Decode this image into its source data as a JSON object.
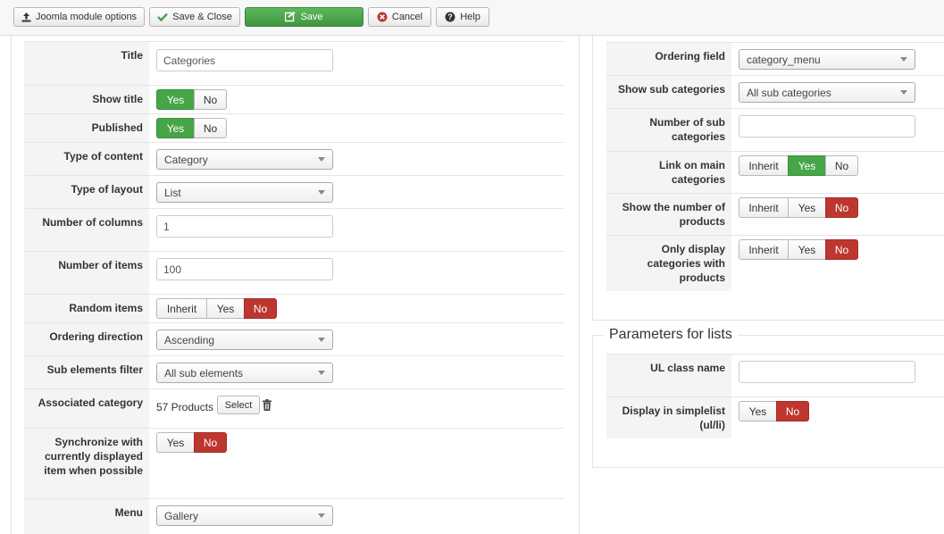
{
  "toolbar": {
    "options_label": "Joomla module options",
    "save_close_label": "Save & Close",
    "save_label": "Save",
    "cancel_label": "Cancel",
    "help_label": "Help"
  },
  "left": {
    "title": {
      "label": "Title",
      "value": "Categories"
    },
    "show_title": {
      "label": "Show title",
      "yes": "Yes",
      "no": "No",
      "selected": "yes"
    },
    "published": {
      "label": "Published",
      "yes": "Yes",
      "no": "No",
      "selected": "yes"
    },
    "type_of_content": {
      "label": "Type of content",
      "value": "Category"
    },
    "type_of_layout": {
      "label": "Type of layout",
      "value": "List"
    },
    "number_of_columns": {
      "label": "Number of columns",
      "value": "1"
    },
    "number_of_items": {
      "label": "Number of items",
      "value": "100"
    },
    "random_items": {
      "label": "Random items",
      "inherit": "Inherit",
      "yes": "Yes",
      "no": "No",
      "selected": "no"
    },
    "ordering_direction": {
      "label": "Ordering direction",
      "value": "Ascending"
    },
    "sub_elements_filter": {
      "label": "Sub elements filter",
      "value": "All sub elements"
    },
    "associated_category": {
      "label": "Associated category",
      "value": "57 Products",
      "select_label": "Select"
    },
    "synchronize": {
      "label": "Synchronize with currently displayed item when possible",
      "yes": "Yes",
      "no": "No",
      "selected": "no"
    },
    "menu": {
      "label": "Menu",
      "value": "Gallery"
    }
  },
  "right": {
    "ordering_field": {
      "label": "Ordering field",
      "value": "category_menu"
    },
    "show_sub_categories": {
      "label": "Show sub categories",
      "value": "All sub categories"
    },
    "number_of_sub_categories": {
      "label": "Number of sub categories",
      "value": ""
    },
    "link_on_main_categories": {
      "label": "Link on main categories",
      "inherit": "Inherit",
      "yes": "Yes",
      "no": "No",
      "selected": "yes"
    },
    "show_number_of_products": {
      "label": "Show the number of products",
      "inherit": "Inherit",
      "yes": "Yes",
      "no": "No",
      "selected": "no"
    },
    "only_display_with_products": {
      "label": "Only display categories with products",
      "inherit": "Inherit",
      "yes": "Yes",
      "no": "No",
      "selected": "no"
    }
  },
  "lists": {
    "legend": "Parameters for lists",
    "ul_class_name": {
      "label": "UL class name",
      "value": ""
    },
    "display_in_simplelist": {
      "label": "Display in simplelist (ul/li)",
      "yes": "Yes",
      "no": "No",
      "selected": "no"
    }
  },
  "colors": {
    "green": "#46a546",
    "red": "#bd362f"
  },
  "icons": [
    "upload-icon",
    "check-icon",
    "edit-save-icon",
    "cancel-icon",
    "help-icon",
    "trash-icon",
    "caret-down-icon"
  ]
}
